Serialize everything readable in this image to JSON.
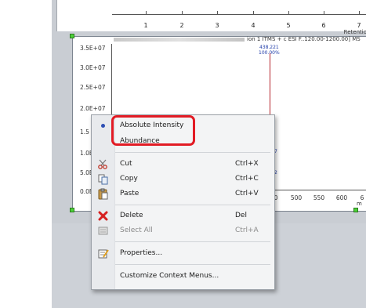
{
  "top_axis": {
    "ticks": [
      "1",
      "2",
      "3",
      "4",
      "5",
      "6",
      "7"
    ],
    "retention_label": "Retentio"
  },
  "spectrum": {
    "header_text": "ion 1 ITMS + c ESI F..120.00-1200.00] MS",
    "peak": {
      "mz": "438.221",
      "percent": "100.00%"
    },
    "y_ticks": [
      "3.5E+07",
      "3.0E+07",
      "2.5E+07",
      "2.0E+07",
      "1.5",
      "1.0E",
      "5.0E",
      "0.0E"
    ],
    "x_ticks": [
      "0",
      "500",
      "550",
      "600",
      "6"
    ],
    "x_unit": "m",
    "marks": [
      "7",
      "2"
    ]
  },
  "context_menu": {
    "sections": [
      [
        {
          "icon": "radio-dot-icon",
          "label": "Absolute Intensity",
          "shortcut": "",
          "enabled": true,
          "checked": true
        },
        {
          "icon": "",
          "label": "Abundance",
          "shortcut": "",
          "enabled": true,
          "checked": false
        }
      ],
      [
        {
          "icon": "scissors-icon",
          "label": "Cut",
          "shortcut": "Ctrl+X",
          "enabled": true
        },
        {
          "icon": "copy-icon",
          "label": "Copy",
          "shortcut": "Ctrl+C",
          "enabled": true
        },
        {
          "icon": "paste-icon",
          "label": "Paste",
          "shortcut": "Ctrl+V",
          "enabled": true
        }
      ],
      [
        {
          "icon": "delete-x-icon",
          "label": "Delete",
          "shortcut": "Del",
          "enabled": true
        },
        {
          "icon": "select-all-icon",
          "label": "Select All",
          "shortcut": "Ctrl+A",
          "enabled": false
        }
      ],
      [
        {
          "icon": "properties-icon",
          "label": "Properties...",
          "shortcut": "",
          "enabled": true
        }
      ],
      [
        {
          "icon": "",
          "label": "Customize Context Menus...",
          "shortcut": "",
          "enabled": true
        }
      ]
    ]
  },
  "colors": {
    "highlight": "#e21b24",
    "handle": "#4cd139",
    "peak": "#b5252c",
    "accent": "#2e4fb4"
  }
}
